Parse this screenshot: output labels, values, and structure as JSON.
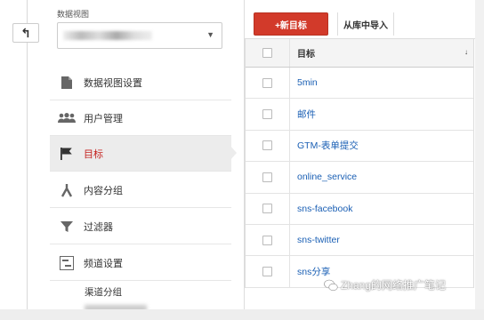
{
  "back_icon": "arrow-back-icon",
  "view": {
    "label": "数据视图",
    "selected": ""
  },
  "nav": {
    "items": [
      {
        "label": "数据视图设置",
        "icon": "document-icon"
      },
      {
        "label": "用户管理",
        "icon": "users-icon"
      },
      {
        "label": "目标",
        "icon": "flag-icon",
        "active": true
      },
      {
        "label": "内容分组",
        "icon": "grouping-icon"
      },
      {
        "label": "过滤器",
        "icon": "filter-icon"
      },
      {
        "label": "频道设置",
        "icon": "channel-settings-icon"
      }
    ],
    "sub_item": "渠道分组"
  },
  "toolbar": {
    "new_goal": "+新目标",
    "import": "从库中导入"
  },
  "table": {
    "header": "目标",
    "rows": [
      "5min",
      "邮件",
      "GTM-表单提交",
      "online_service",
      "sns-facebook",
      "sns-twitter",
      "sns分享"
    ]
  },
  "watermark": "Zhang的网络推广笔记",
  "colors": {
    "accent_red": "#d23a2a",
    "active_text": "#c5221f",
    "link_blue": "#1a5fb4"
  }
}
